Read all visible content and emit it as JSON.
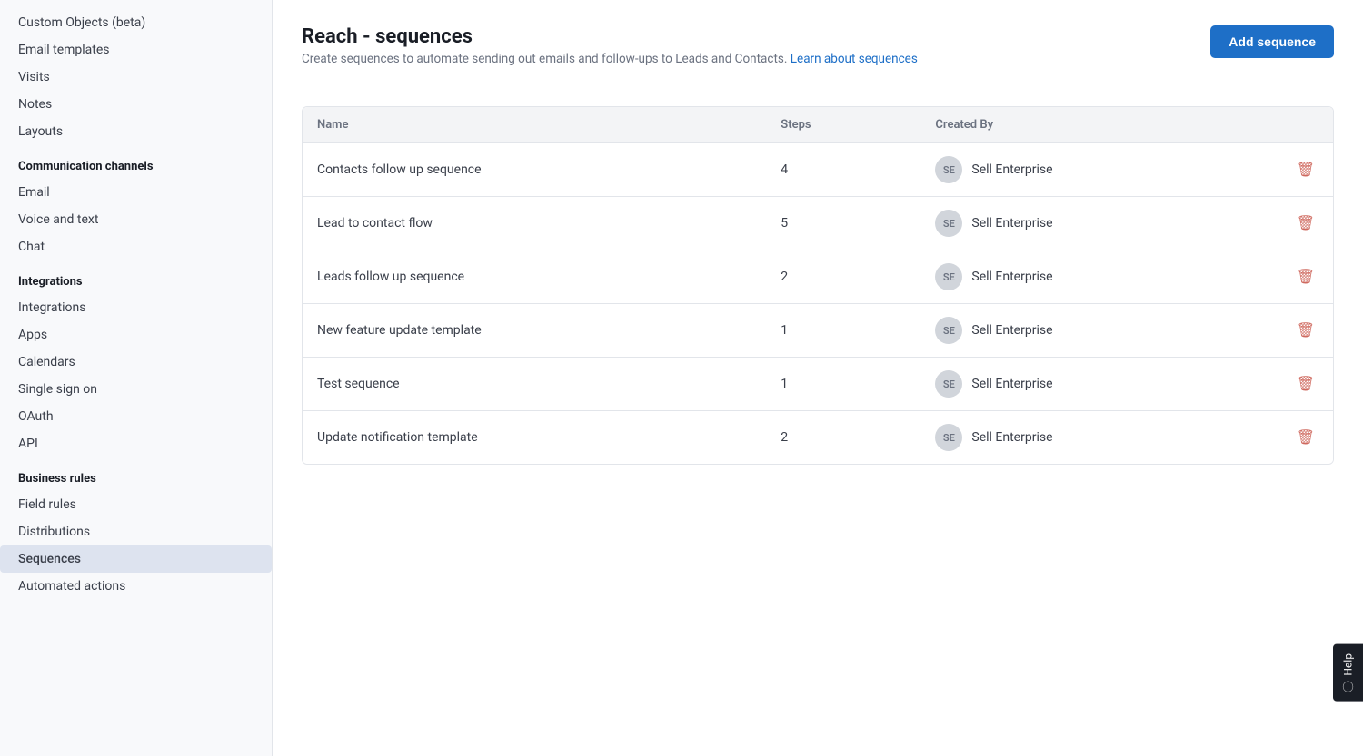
{
  "sidebar": {
    "items_top": [
      {
        "id": "custom-objects",
        "label": "Custom Objects (beta)",
        "active": false
      },
      {
        "id": "email-templates",
        "label": "Email templates",
        "active": false
      },
      {
        "id": "visits",
        "label": "Visits",
        "active": false
      },
      {
        "id": "notes",
        "label": "Notes",
        "active": false
      },
      {
        "id": "layouts",
        "label": "Layouts",
        "active": false
      }
    ],
    "sections": [
      {
        "id": "communication-channels",
        "label": "Communication channels",
        "items": [
          {
            "id": "email",
            "label": "Email",
            "active": false
          },
          {
            "id": "voice-and-text",
            "label": "Voice and text",
            "active": false
          },
          {
            "id": "chat",
            "label": "Chat",
            "active": false
          }
        ]
      },
      {
        "id": "integrations",
        "label": "Integrations",
        "items": [
          {
            "id": "integrations",
            "label": "Integrations",
            "active": false
          },
          {
            "id": "apps",
            "label": "Apps",
            "active": false
          },
          {
            "id": "calendars",
            "label": "Calendars",
            "active": false
          },
          {
            "id": "single-sign-on",
            "label": "Single sign on",
            "active": false
          },
          {
            "id": "oauth",
            "label": "OAuth",
            "active": false
          },
          {
            "id": "api",
            "label": "API",
            "active": false
          }
        ]
      },
      {
        "id": "business-rules",
        "label": "Business rules",
        "items": [
          {
            "id": "field-rules",
            "label": "Field rules",
            "active": false
          },
          {
            "id": "distributions",
            "label": "Distributions",
            "active": false
          },
          {
            "id": "sequences",
            "label": "Sequences",
            "active": true
          },
          {
            "id": "automated-actions",
            "label": "Automated actions",
            "active": false
          }
        ]
      }
    ]
  },
  "main": {
    "title": "Reach - sequences",
    "subtitle": "Create sequences to automate sending out emails and follow-ups to Leads and Contacts.",
    "learn_link": "Learn about sequences",
    "add_button": "Add sequence",
    "table": {
      "columns": [
        "Name",
        "Steps",
        "Created By"
      ],
      "rows": [
        {
          "id": 1,
          "name": "Contacts follow up sequence",
          "steps": "4",
          "created_by_initials": "SE",
          "created_by_name": "Sell Enterprise"
        },
        {
          "id": 2,
          "name": "Lead to contact flow",
          "steps": "5",
          "created_by_initials": "SE",
          "created_by_name": "Sell Enterprise"
        },
        {
          "id": 3,
          "name": "Leads follow up sequence",
          "steps": "2",
          "created_by_initials": "SE",
          "created_by_name": "Sell Enterprise"
        },
        {
          "id": 4,
          "name": "New feature update template",
          "steps": "1",
          "created_by_initials": "SE",
          "created_by_name": "Sell Enterprise"
        },
        {
          "id": 5,
          "name": "Test sequence",
          "steps": "1",
          "created_by_initials": "SE",
          "created_by_name": "Sell Enterprise"
        },
        {
          "id": 6,
          "name": "Update notification template",
          "steps": "2",
          "created_by_initials": "SE",
          "created_by_name": "Sell Enterprise"
        }
      ]
    }
  },
  "help": {
    "label": "Help"
  }
}
